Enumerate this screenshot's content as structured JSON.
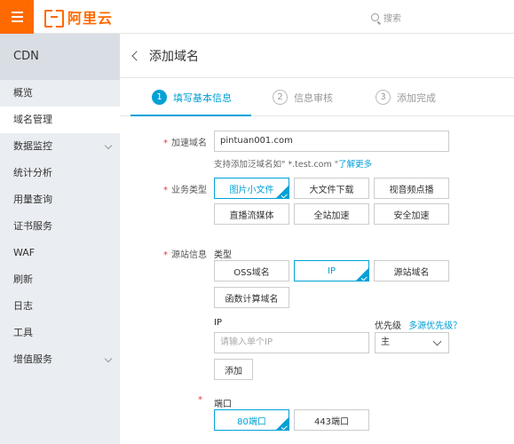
{
  "header": {
    "logo_text": "阿里云",
    "search_label": "搜索"
  },
  "sidebar": {
    "title": "CDN",
    "items": [
      {
        "label": "概览",
        "active": false,
        "expandable": false
      },
      {
        "label": "域名管理",
        "active": true,
        "expandable": false
      },
      {
        "label": "数据监控",
        "active": false,
        "expandable": true
      },
      {
        "label": "统计分析",
        "active": false,
        "expandable": false
      },
      {
        "label": "用量查询",
        "active": false,
        "expandable": false
      },
      {
        "label": "证书服务",
        "active": false,
        "expandable": false
      },
      {
        "label": "WAF",
        "active": false,
        "expandable": false
      },
      {
        "label": "刷新",
        "active": false,
        "expandable": false
      },
      {
        "label": "日志",
        "active": false,
        "expandable": false
      },
      {
        "label": "工具",
        "active": false,
        "expandable": false
      },
      {
        "label": "增值服务",
        "active": false,
        "expandable": true
      }
    ]
  },
  "page": {
    "title": "添加域名"
  },
  "steps": [
    {
      "num": "1",
      "label": "填写基本信息",
      "active": true
    },
    {
      "num": "2",
      "label": "信息审核",
      "active": false
    },
    {
      "num": "3",
      "label": "添加完成",
      "active": false
    }
  ],
  "form": {
    "required_mark": "*",
    "domain": {
      "label": "加速域名",
      "value": "pintuan001.com",
      "hint_prefix": "支持添加泛域名如\" *.test.com \"",
      "hint_link": "了解更多"
    },
    "business": {
      "label": "业务类型",
      "options": [
        {
          "label": "图片小文件",
          "selected": true
        },
        {
          "label": "大文件下载",
          "selected": false
        },
        {
          "label": "视音频点播",
          "selected": false
        },
        {
          "label": "直播流媒体",
          "selected": false
        },
        {
          "label": "全站加速",
          "selected": false
        },
        {
          "label": "安全加速",
          "selected": false
        }
      ]
    },
    "origin": {
      "label": "源站信息",
      "type_label": "类型",
      "types": [
        {
          "label": "OSS域名",
          "selected": false
        },
        {
          "label": "IP",
          "selected": true
        },
        {
          "label": "源站域名",
          "selected": false
        },
        {
          "label": "函数计算域名",
          "selected": false
        }
      ],
      "ip_label": "IP",
      "ip_placeholder": "请输入单个IP",
      "priority_label": "优先级",
      "priority_link": "多源优先级？",
      "priority_value": "主",
      "add_button": "添加"
    },
    "port": {
      "label": "端口",
      "options": [
        {
          "label": "80端口",
          "selected": true
        },
        {
          "label": "443端口",
          "selected": false
        }
      ]
    }
  },
  "colors": {
    "brand": "#ff6a00",
    "accent": "#00a1d6",
    "required": "#e4393c"
  }
}
